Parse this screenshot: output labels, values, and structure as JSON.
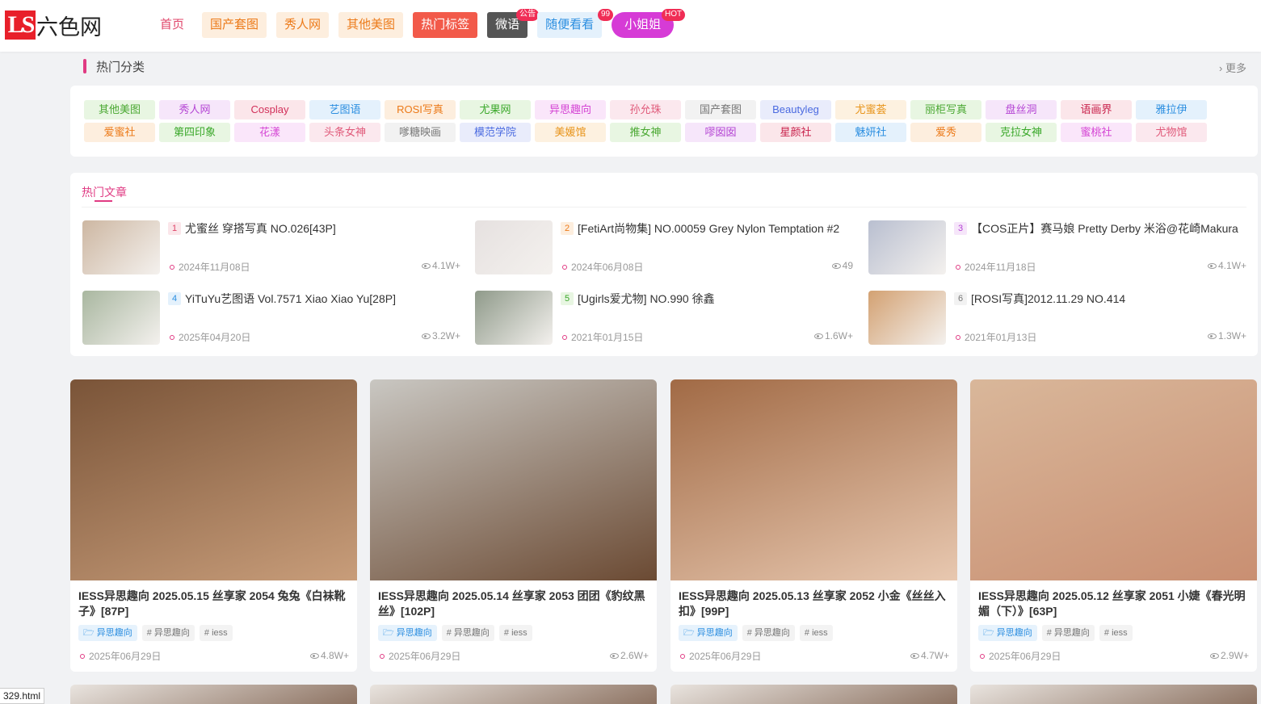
{
  "logo": {
    "mark": "LS",
    "text": "六色网"
  },
  "nav": [
    {
      "label": "首页",
      "bg": "#ffffff",
      "color": "#e0456a",
      "badge": ""
    },
    {
      "label": "国产套图",
      "bg": "#fdeede",
      "color": "#ec7a19",
      "badge": ""
    },
    {
      "label": "秀人网",
      "bg": "#fdeede",
      "color": "#ec7a19",
      "badge": ""
    },
    {
      "label": "其他美图",
      "bg": "#fdeede",
      "color": "#ec7a19",
      "badge": ""
    },
    {
      "label": "热门标签",
      "bg": "#f25a4a",
      "color": "#ffffff",
      "badge": ""
    },
    {
      "label": "微语",
      "bg": "#555555",
      "color": "#ffffff",
      "badge": "公告"
    },
    {
      "label": "随便看看",
      "bg": "#e4f1fc",
      "color": "#2b8ee0",
      "badge": "99"
    },
    {
      "label": "小姐姐",
      "bg": "#d63bd6",
      "color": "#ffffff",
      "badge": "HOT"
    }
  ],
  "categories": {
    "title": "热门分类",
    "more": "更多",
    "tags": [
      {
        "label": "其他美图",
        "bg": "#e8f6e2",
        "color": "#4aa832"
      },
      {
        "label": "秀人网",
        "bg": "#f6e6fa",
        "color": "#b444d4"
      },
      {
        "label": "Cosplay",
        "bg": "#fbe6ea",
        "color": "#d2305a"
      },
      {
        "label": "艺图语",
        "bg": "#e4f1fc",
        "color": "#2b8ee0"
      },
      {
        "label": "ROSI写真",
        "bg": "#fdeede",
        "color": "#ec7a19"
      },
      {
        "label": "尤果网",
        "bg": "#e8f6e2",
        "color": "#3aa82a"
      },
      {
        "label": "异思趣向",
        "bg": "#fae6fa",
        "color": "#d444d4"
      },
      {
        "label": "孙允珠",
        "bg": "#fbe8ee",
        "color": "#e05a7a"
      },
      {
        "label": "国产套图",
        "bg": "#f2f2f2",
        "color": "#777777"
      },
      {
        "label": "Beautyleg",
        "bg": "#e9ecfb",
        "color": "#4a6ae0"
      },
      {
        "label": "尤蜜荟",
        "bg": "#fdf1e0",
        "color": "#e8941a"
      },
      {
        "label": "丽柜写真",
        "bg": "#e8f6e2",
        "color": "#4aa832"
      },
      {
        "label": "盘丝洞",
        "bg": "#f6e6fa",
        "color": "#b444d4"
      },
      {
        "label": "语画界",
        "bg": "#fbe6ea",
        "color": "#c8204a"
      },
      {
        "label": "雅拉伊",
        "bg": "#e4f1fc",
        "color": "#2b8ee0"
      },
      {
        "label": "爱蜜社",
        "bg": "#fdeede",
        "color": "#ec7a19"
      },
      {
        "label": "第四印象",
        "bg": "#e8f6e2",
        "color": "#3aa82a"
      },
      {
        "label": "花漾",
        "bg": "#fae6fa",
        "color": "#d444d4"
      },
      {
        "label": "头条女神",
        "bg": "#fbe8ee",
        "color": "#e05a7a"
      },
      {
        "label": "嗲糖映画",
        "bg": "#f2f2f2",
        "color": "#777777"
      },
      {
        "label": "模范学院",
        "bg": "#e9ecfb",
        "color": "#4a6ae0"
      },
      {
        "label": "美媛馆",
        "bg": "#fdf1e0",
        "color": "#e8941a"
      },
      {
        "label": "推女神",
        "bg": "#e8f6e2",
        "color": "#4aa832"
      },
      {
        "label": "嘐囡囡",
        "bg": "#f6e6fa",
        "color": "#b444d4"
      },
      {
        "label": "星颜社",
        "bg": "#fbe6ea",
        "color": "#c8204a"
      },
      {
        "label": "魅妍社",
        "bg": "#e4f1fc",
        "color": "#2b8ee0"
      },
      {
        "label": "爱秀",
        "bg": "#fdeede",
        "color": "#ec7a19"
      },
      {
        "label": "克拉女神",
        "bg": "#e8f6e2",
        "color": "#3aa82a"
      },
      {
        "label": "蜜桃社",
        "bg": "#fae6fa",
        "color": "#d444d4"
      },
      {
        "label": "尤物馆",
        "bg": "#fbe8ee",
        "color": "#e05a7a"
      }
    ]
  },
  "hot": {
    "tab": "热门文章",
    "items": [
      {
        "rank": "1",
        "title": "尤蜜丝 穿搭写真 NO.026[43P]",
        "date": "2024年11月08日",
        "views": "4.1W+",
        "rank_bg": "#fbe6ea",
        "rank_color": "#e0456a",
        "thumb": "#cdb7a2"
      },
      {
        "rank": "2",
        "title": "[FetiArt尚物集] NO.00059 Grey Nylon Temptation #2",
        "date": "2024年06月08日",
        "views": "49",
        "rank_bg": "#fdeede",
        "rank_color": "#ec7a19",
        "thumb": "#e6e1e0"
      },
      {
        "rank": "3",
        "title": "【COS正片】赛马娘 Pretty Derby 米浴@花崎Makura",
        "date": "2024年11月18日",
        "views": "4.1W+",
        "rank_bg": "#f6e6fa",
        "rank_color": "#b444d4",
        "thumb": "#b9bfd0"
      },
      {
        "rank": "4",
        "title": "YiTuYu艺图语 Vol.7571 Xiao Xiao Yu[28P]",
        "date": "2025年04月20日",
        "views": "3.2W+",
        "rank_bg": "#e4f1fc",
        "rank_color": "#2b8ee0",
        "thumb": "#a9b7a0"
      },
      {
        "rank": "5",
        "title": "[Ugirls爱尤物] NO.990 徐鑫",
        "date": "2021年01月15日",
        "views": "1.6W+",
        "rank_bg": "#e8f6e2",
        "rank_color": "#3aa82a",
        "thumb": "#8f9a8a"
      },
      {
        "rank": "6",
        "title": "[ROSI写真]2012.11.29 NO.414",
        "date": "2021年01月13日",
        "views": "1.3W+",
        "rank_bg": "#f2f2f2",
        "rank_color": "#777777",
        "thumb": "#d3a172"
      }
    ]
  },
  "posts": [
    {
      "title": "IESS异思趣向 2025.05.15 丝享家 2054 兔兔《白袜靴子》[87P]",
      "tags": [
        "异思趣向",
        "# 异思趣向",
        "# iess"
      ],
      "date": "2025年06月29日",
      "views": "4.8W+",
      "img_top": "#7a5438",
      "img_bottom": "#c89d7a"
    },
    {
      "title": "IESS异思趣向 2025.05.14 丝享家 2053 团团《豹纹黑丝》[102P]",
      "tags": [
        "异思趣向",
        "# 异思趣向",
        "# iess"
      ],
      "date": "2025年06月29日",
      "views": "2.6W+",
      "img_top": "#c9c7c2",
      "img_bottom": "#6b4a33"
    },
    {
      "title": "IESS异思趣向 2025.05.13 丝享家 2052 小金《丝丝入扣》[99P]",
      "tags": [
        "异思趣向",
        "# 异思趣向",
        "# iess"
      ],
      "date": "2025年06月29日",
      "views": "4.7W+",
      "img_top": "#a16a45",
      "img_bottom": "#e8c8b0"
    },
    {
      "title": "IESS异思趣向 2025.05.12 丝享家 2051 小婕《春光明媚（下）》[63P]",
      "tags": [
        "异思趣向",
        "# 异思趣向",
        "# iess"
      ],
      "date": "2025年06月29日",
      "views": "2.9W+",
      "img_top": "#d9b79a",
      "img_bottom": "#c98f72"
    }
  ],
  "status_url": "329.html"
}
